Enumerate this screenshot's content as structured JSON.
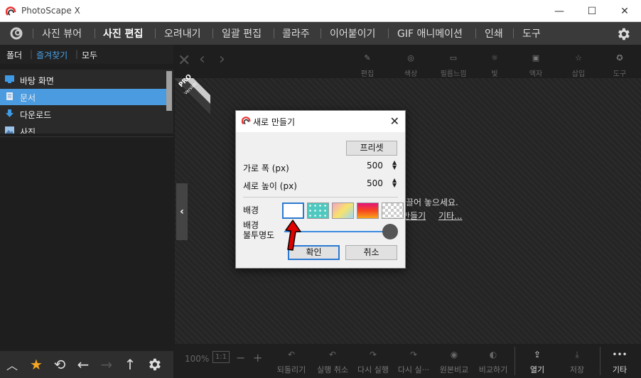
{
  "app": {
    "title": "PhotoScape X"
  },
  "menu": {
    "items": [
      "사진 뷰어",
      "사진 편집",
      "오려내기",
      "일괄 편집",
      "콜라주",
      "이어붙이기",
      "GIF 애니메이션",
      "인쇄",
      "도구"
    ],
    "active_index": 1
  },
  "left_panel": {
    "tabs": [
      "폴더",
      "즐겨찾기",
      "모두"
    ],
    "selected_tab": 1,
    "folders": [
      {
        "label": "바탕 화면",
        "icon": "desktop-icon"
      },
      {
        "label": "문서",
        "icon": "document-icon"
      },
      {
        "label": "다운로드",
        "icon": "download-icon"
      },
      {
        "label": "사진",
        "icon": "picture-icon"
      }
    ],
    "selected_folder": 1
  },
  "top_tools": [
    "편집",
    "색상",
    "필름느낌",
    "빛",
    "액자",
    "삽입",
    "도구"
  ],
  "bottom_tools": {
    "zoom": "100%",
    "ratio": "1:1",
    "items": [
      "되돌리기",
      "실행 취소",
      "다시 실행",
      "다시 실···",
      "원본비교",
      "비교하기",
      "열기",
      "저장",
      "기타"
    ]
  },
  "badge": {
    "line1": "PRO",
    "line2": "Version"
  },
  "hint": {
    "text": "끌어 놓으세요.",
    "link1": "만들기",
    "link2": "기타..."
  },
  "dialog": {
    "title": "새로 만들기",
    "preset_button": "프리셋",
    "width_label": "가로 폭 (px)",
    "width_value": "500",
    "height_label": "세로 높이 (px)",
    "height_value": "500",
    "background_label": "배경",
    "opacity_label_line1": "배경",
    "opacity_label_line2": "불투명도",
    "opacity_value": 1.0,
    "ok_button": "확인",
    "cancel_button": "취소"
  },
  "colors": {
    "accent": "#4a9be0",
    "menu_bg": "#3a3a3a",
    "arrow": "#e00000",
    "star": "#f5a623"
  }
}
